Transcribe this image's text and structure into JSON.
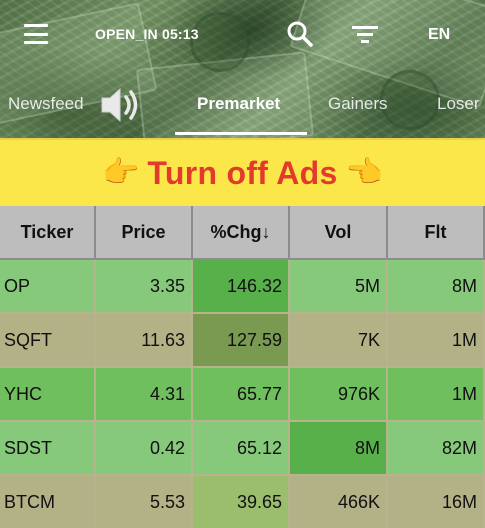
{
  "header": {
    "status": "OPEN_IN 05:13",
    "language": "EN",
    "icons": {
      "menu": "hamburger-menu-icon",
      "search": "search-icon",
      "filter": "filter-icon",
      "sound": "speaker-icon"
    }
  },
  "tabs": [
    {
      "label": "Newsfeed",
      "active": false
    },
    {
      "label": "Premarket",
      "active": true
    },
    {
      "label": "Gainers",
      "active": false
    },
    {
      "label": "Loser",
      "active": false
    }
  ],
  "ad": {
    "text": "Turn off Ads",
    "emoji_left": "👉",
    "emoji_right": "👈"
  },
  "table": {
    "columns": [
      "Ticker",
      "Price",
      "%Chg↓",
      "Vol",
      "Flt"
    ],
    "rows": [
      {
        "ticker": "OP",
        "price": "3.35",
        "chg": "146.32",
        "vol": "5M",
        "flt": "8M"
      },
      {
        "ticker": "SQFT",
        "price": "11.63",
        "chg": "127.59",
        "vol": "7K",
        "flt": "1M"
      },
      {
        "ticker": "YHC",
        "price": "4.31",
        "chg": "65.77",
        "vol": "976K",
        "flt": "1M"
      },
      {
        "ticker": "SDST",
        "price": "0.42",
        "chg": "65.12",
        "vol": "8M",
        "flt": "82M"
      },
      {
        "ticker": "BTCM",
        "price": "5.53",
        "chg": "39.65",
        "vol": "466K",
        "flt": "16M"
      }
    ]
  },
  "colors": {
    "header_text": "#ffffff",
    "ad_background": "#fce74a",
    "ad_text": "#e23a2c",
    "header_cell": "#bdbdbd",
    "row_green_bright": "#86c97a",
    "row_green_deep": "#58b04a",
    "row_olive": "#b3b186",
    "row_olive_deep": "#7a9a52",
    "row_mixed": "#6fbf5e",
    "row_mixed_deep": "#9bbd6e"
  }
}
